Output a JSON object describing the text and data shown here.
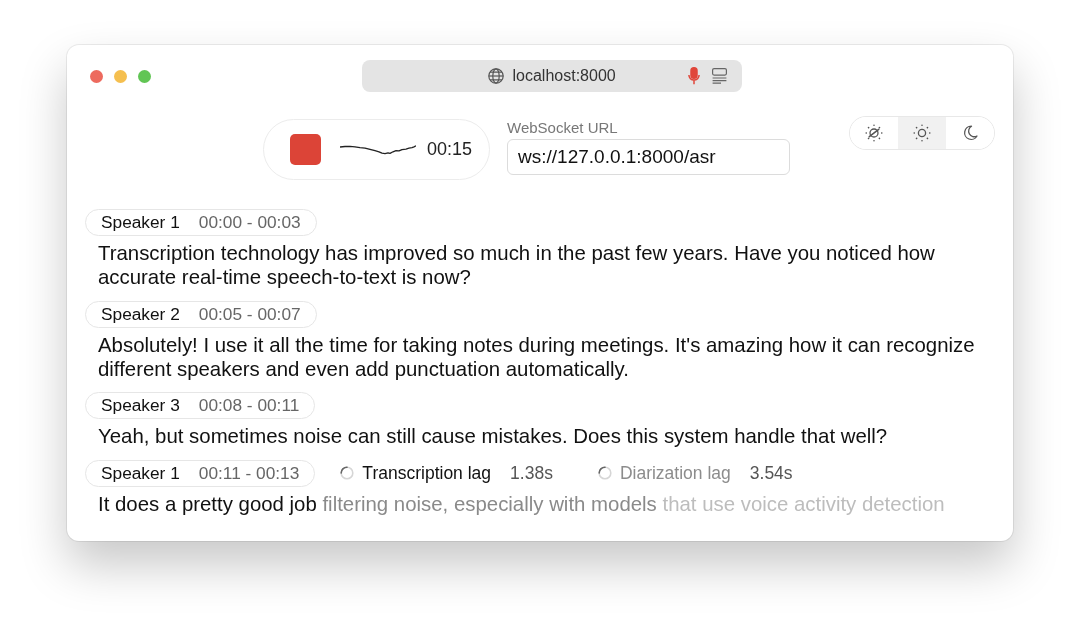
{
  "address_bar": {
    "url": "localhost:8000"
  },
  "recorder": {
    "recording": true,
    "timer": "00:15"
  },
  "websocket": {
    "label": "WebSocket URL",
    "value": "ws://127.0.0.1:8000/asr"
  },
  "theme_toggle": [
    {
      "kind": "system",
      "selected": false
    },
    {
      "kind": "light",
      "selected": true
    },
    {
      "kind": "dark",
      "selected": false
    }
  ],
  "transcript": [
    {
      "speaker": "Speaker 1",
      "time": "00:00 - 00:03",
      "parts": [
        {
          "kind": "final",
          "text": "Transcription technology has improved so much in the past few years. Have you noticed how accurate real-time speech-to-text is now?"
        }
      ]
    },
    {
      "speaker": "Speaker 2",
      "time": "00:05 - 00:07",
      "parts": [
        {
          "kind": "final",
          "text": "Absolutely! I use it all the time for taking notes during meetings. It's amazing how it can recognize different speakers and even add punctuation automatically."
        }
      ]
    },
    {
      "speaker": "Speaker 3",
      "time": "00:08 - 00:11",
      "parts": [
        {
          "kind": "final",
          "text": "Yeah, but sometimes noise can still cause mistakes. Does this system handle that well?"
        }
      ]
    },
    {
      "speaker": "Speaker 1",
      "time": "00:11 - 00:13",
      "lags": [
        {
          "label": "Transcription lag",
          "value": "1.38s",
          "dimmed": false
        },
        {
          "label": "Diarization lag",
          "value": "3.54s",
          "dimmed": true
        }
      ],
      "parts": [
        {
          "kind": "final",
          "text": "It does a pretty good job"
        },
        {
          "kind": "pending",
          "text": "filtering noise, especially with models"
        },
        {
          "kind": "buffer",
          "text": "that use voice activity detection"
        }
      ]
    }
  ]
}
